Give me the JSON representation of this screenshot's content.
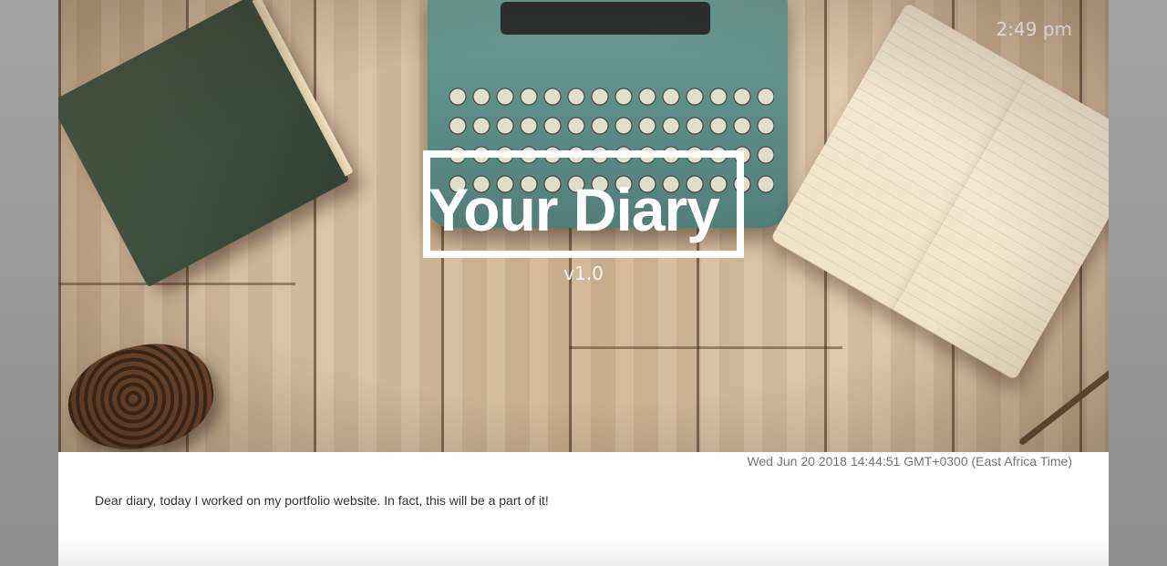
{
  "header": {
    "clock": "2:49 pm",
    "title": "Your Diary",
    "version": "v1.0"
  },
  "entry": {
    "date": "Wed Jun 20 2018 14:44:51 GMT+0300 (East Africa Time)",
    "text": "Dear diary, today I worked on my portfolio website. In fact, this will be a part of it!"
  },
  "colors": {
    "title": "#ffffff",
    "date_text": "#757575",
    "body_text": "#333333"
  }
}
